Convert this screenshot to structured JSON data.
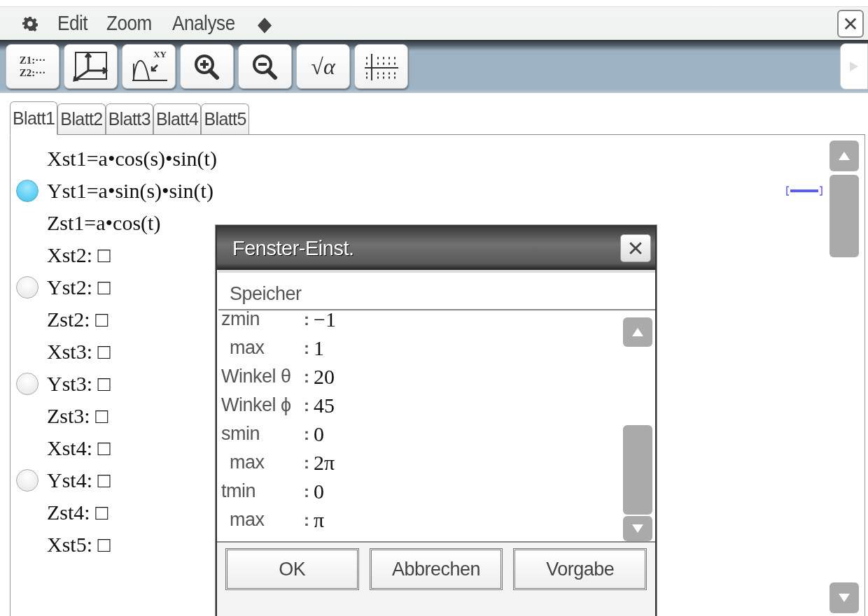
{
  "menu_bar": {
    "items": [
      "Edit",
      "Zoom",
      "Analyse",
      "◆"
    ]
  },
  "toolbar": [
    {
      "kind": "memory",
      "lines": [
        "Z1:···",
        "Z2:···"
      ]
    },
    {
      "kind": "axes"
    },
    {
      "kind": "trace",
      "text": "XY"
    },
    {
      "kind": "zoom-in"
    },
    {
      "kind": "zoom-out"
    },
    {
      "kind": "sqrt",
      "text": "√α"
    },
    {
      "kind": "grid"
    }
  ],
  "tabs": [
    {
      "label": "Blatt1",
      "selected": true
    },
    {
      "label": "Blatt2",
      "selected": false
    },
    {
      "label": "Blatt3",
      "selected": false
    },
    {
      "label": "Blatt4",
      "selected": false
    },
    {
      "label": "Blatt5",
      "selected": false
    }
  ],
  "equations": [
    {
      "text": "Xst1=a•cos(s)•sin(t)"
    },
    {
      "text": "Yst1=a•sin(s)•sin(t)",
      "selected": true
    },
    {
      "text": "Zst1=a•cos(t)"
    },
    {
      "text": "Xst2: □"
    },
    {
      "text": "Yst2: □",
      "selected": false
    },
    {
      "text": "Zst2: □"
    },
    {
      "text": "Xst3: □"
    },
    {
      "text": "Yst3: □",
      "selected": false
    },
    {
      "text": "Zst3: □"
    },
    {
      "text": "Xst4: □"
    },
    {
      "text": "Yst4: □",
      "selected": false
    },
    {
      "text": "Zst4: □"
    },
    {
      "text": "Xst5: □"
    }
  ],
  "dialog": {
    "title": "Fenster-Einst.",
    "memory_label": "Speicher",
    "fields": [
      {
        "label": "zmin",
        "colon": ":",
        "value": "−1",
        "sub": false
      },
      {
        "label": "max",
        "colon": ":",
        "value": "1",
        "sub": true
      },
      {
        "label": "Winkel θ",
        "colon": ":",
        "value": "20",
        "sub": false
      },
      {
        "label": "Winkel ϕ",
        "colon": ":",
        "value": "45",
        "sub": false
      },
      {
        "label": "smin",
        "colon": ":",
        "value": "0",
        "sub": false
      },
      {
        "label": "max",
        "colon": ":",
        "value": "2π",
        "sub": true
      },
      {
        "label": "tmin",
        "colon": ":",
        "value": "0",
        "sub": false
      },
      {
        "label": "max",
        "colon": ":",
        "value": "π",
        "sub": true
      }
    ],
    "buttons": [
      "OK",
      "Abbrechen",
      "Vorgabe"
    ]
  }
}
